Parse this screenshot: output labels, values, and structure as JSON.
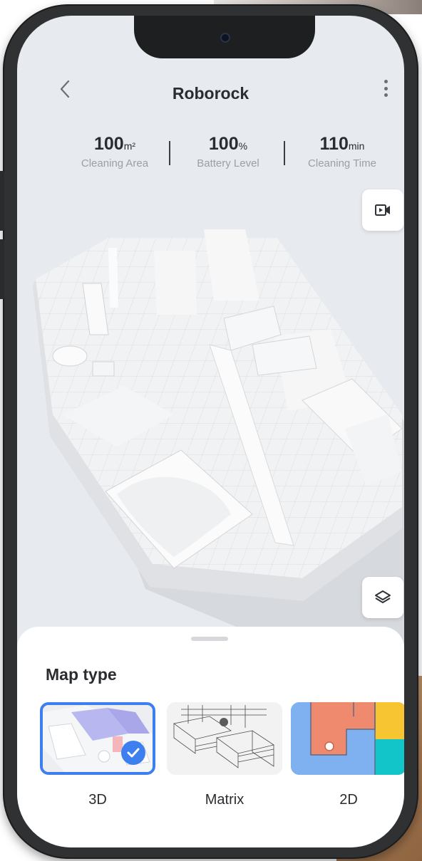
{
  "header": {
    "title": "Roborock",
    "back_icon": "chevron-left-icon",
    "more_icon": "more-vertical-icon"
  },
  "stats": [
    {
      "value": "100",
      "unit": "m²",
      "label": "Cleaning Area"
    },
    {
      "value": "100",
      "unit": "%",
      "label": "Battery Level"
    },
    {
      "value": "110",
      "unit": "min",
      "label": "Cleaning Time"
    }
  ],
  "buttons": {
    "video_icon": "video-camera-icon",
    "layers_icon": "layers-icon"
  },
  "sheet": {
    "title": "Map type",
    "options": [
      {
        "label": "3D",
        "selected": true
      },
      {
        "label": "Matrix",
        "selected": false
      },
      {
        "label": "2D",
        "selected": false
      }
    ]
  },
  "colors": {
    "accent": "#3e7ff0",
    "screen_bg": "#e7eaee",
    "frame": "#2f3133",
    "map2d_orange": "#f08a6e",
    "map2d_blue": "#7fb0ef",
    "map2d_yellow": "#f7c531",
    "map2d_teal": "#12c5c8"
  }
}
